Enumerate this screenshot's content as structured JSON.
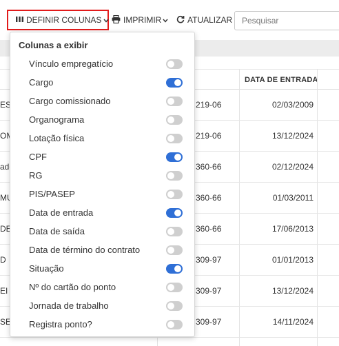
{
  "toolbar": {
    "define_columns_label": "DEFINIR COLUNAS",
    "print_label": "IMPRIMIR",
    "refresh_label": "ATUALIZAR",
    "search_placeholder": "Pesquisar"
  },
  "table": {
    "visible_header": "DATA DE ENTRADA",
    "rows": [
      {
        "a": "ES",
        "b": "219-06",
        "c": "02/03/2009"
      },
      {
        "a": "OM",
        "b": "219-06",
        "c": "13/12/2024"
      },
      {
        "a": "ado",
        "b": "360-66",
        "c": "02/12/2024"
      },
      {
        "a": "MU",
        "b": "360-66",
        "c": "01/03/2011"
      },
      {
        "a": "DE",
        "b": "360-66",
        "c": "17/06/2013"
      },
      {
        "a": "D",
        "b": "309-97",
        "c": "01/01/2013"
      },
      {
        "a": "EI",
        "b": "309-97",
        "c": "13/12/2024"
      },
      {
        "a": "SEI",
        "b": "309-97",
        "c": "14/11/2024"
      }
    ]
  },
  "dropdown": {
    "title": "Colunas a exibir",
    "items": [
      {
        "label": "Vínculo empregatício",
        "on": false
      },
      {
        "label": "Cargo",
        "on": true
      },
      {
        "label": "Cargo comissionado",
        "on": false
      },
      {
        "label": "Organograma",
        "on": false
      },
      {
        "label": "Lotação física",
        "on": false
      },
      {
        "label": "CPF",
        "on": true
      },
      {
        "label": "RG",
        "on": false
      },
      {
        "label": "PIS/PASEP",
        "on": false
      },
      {
        "label": "Data de entrada",
        "on": true
      },
      {
        "label": "Data de saída",
        "on": false
      },
      {
        "label": "Data de término do contrato",
        "on": false
      },
      {
        "label": "Situação",
        "on": true
      },
      {
        "label": "Nº do cartão do ponto",
        "on": false
      },
      {
        "label": "Jornada de trabalho",
        "on": false
      },
      {
        "label": "Registra ponto?",
        "on": false
      }
    ]
  },
  "colors": {
    "accent": "#2f6fd6",
    "highlight_border": "#e21b1b",
    "toggle_off": "#cfcfcf"
  },
  "icons": {
    "define": "columns-icon",
    "print": "printer-icon",
    "refresh": "refresh-icon",
    "caret": "chevron-down-icon"
  }
}
